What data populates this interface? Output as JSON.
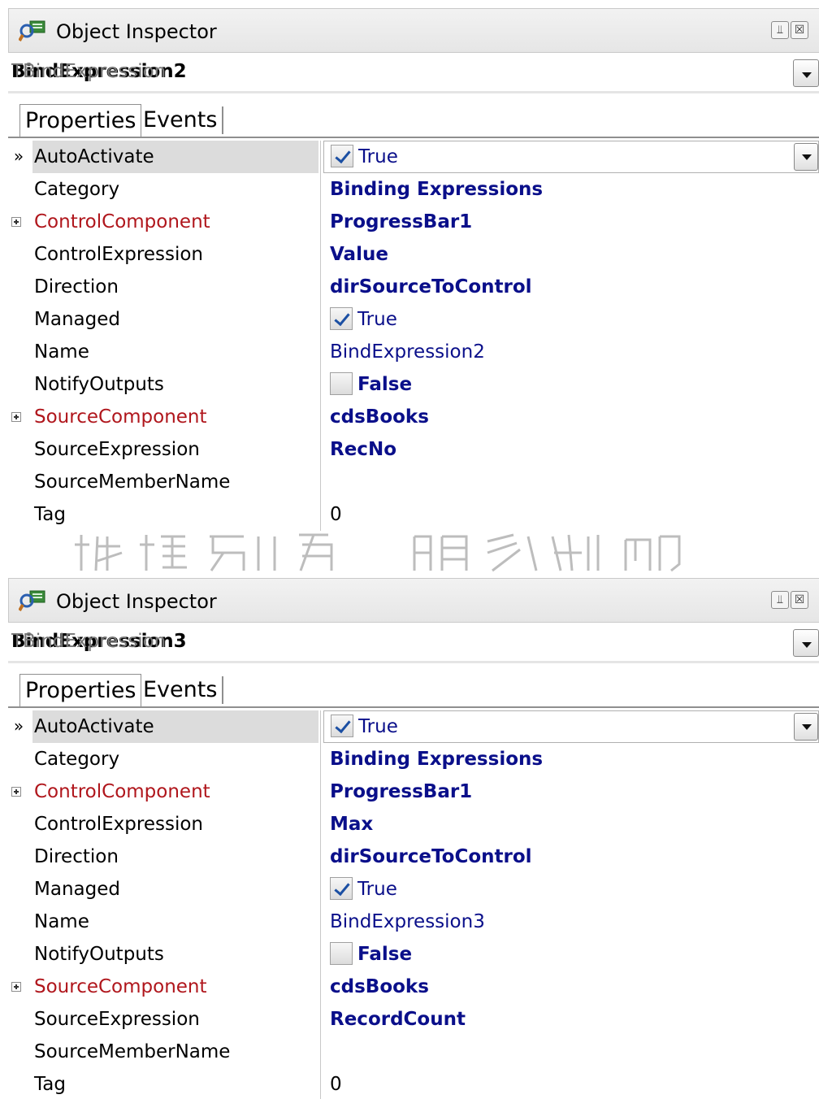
{
  "panels": [
    {
      "title": "Object Inspector",
      "object_name": "BindExpression2",
      "object_class": "TBindExpression",
      "tabs": [
        "Properties",
        "Events"
      ],
      "rows": [
        {
          "name": "AutoActivate",
          "value": "True",
          "kind": "check",
          "checked": true,
          "selected": true,
          "expandable": false,
          "red": false
        },
        {
          "name": "Category",
          "value": "Binding Expressions",
          "kind": "bold",
          "expandable": false,
          "red": false
        },
        {
          "name": "ControlComponent",
          "value": "ProgressBar1",
          "kind": "bold",
          "expandable": true,
          "red": true
        },
        {
          "name": "ControlExpression",
          "value": "Value",
          "kind": "bold",
          "expandable": false,
          "red": false
        },
        {
          "name": "Direction",
          "value": "dirSourceToControl",
          "kind": "bold",
          "expandable": false,
          "red": false
        },
        {
          "name": "Managed",
          "value": "True",
          "kind": "check",
          "checked": true,
          "expandable": false,
          "red": false
        },
        {
          "name": "Name",
          "value": "BindExpression2",
          "kind": "plain",
          "expandable": false,
          "red": false
        },
        {
          "name": "NotifyOutputs",
          "value": "False",
          "kind": "check",
          "checked": false,
          "expandable": false,
          "red": false
        },
        {
          "name": "SourceComponent",
          "value": "cdsBooks",
          "kind": "bold",
          "expandable": true,
          "red": true
        },
        {
          "name": "SourceExpression",
          "value": "RecNo",
          "kind": "bold",
          "expandable": false,
          "red": false
        },
        {
          "name": "SourceMemberName",
          "value": "",
          "kind": "plain",
          "expandable": false,
          "red": false
        },
        {
          "name": "Tag",
          "value": "0",
          "kind": "black",
          "expandable": false,
          "red": false
        }
      ]
    },
    {
      "title": "Object Inspector",
      "object_name": "BindExpression3",
      "object_class": "TBindExpression",
      "tabs": [
        "Properties",
        "Events"
      ],
      "rows": [
        {
          "name": "AutoActivate",
          "value": "True",
          "kind": "check",
          "checked": true,
          "selected": true,
          "expandable": false,
          "red": false
        },
        {
          "name": "Category",
          "value": "Binding Expressions",
          "kind": "bold",
          "expandable": false,
          "red": false
        },
        {
          "name": "ControlComponent",
          "value": "ProgressBar1",
          "kind": "bold",
          "expandable": true,
          "red": true
        },
        {
          "name": "ControlExpression",
          "value": "Max",
          "kind": "bold",
          "expandable": false,
          "red": false
        },
        {
          "name": "Direction",
          "value": "dirSourceToControl",
          "kind": "bold",
          "expandable": false,
          "red": false
        },
        {
          "name": "Managed",
          "value": "True",
          "kind": "check",
          "checked": true,
          "expandable": false,
          "red": false
        },
        {
          "name": "Name",
          "value": "BindExpression3",
          "kind": "plain",
          "expandable": false,
          "red": false
        },
        {
          "name": "NotifyOutputs",
          "value": "False",
          "kind": "check",
          "checked": false,
          "expandable": false,
          "red": false
        },
        {
          "name": "SourceComponent",
          "value": "cdsBooks",
          "kind": "bold",
          "expandable": true,
          "red": true
        },
        {
          "name": "SourceExpression",
          "value": "RecordCount",
          "kind": "bold",
          "expandable": false,
          "red": false
        },
        {
          "name": "SourceMemberName",
          "value": "",
          "kind": "plain",
          "expandable": false,
          "red": false
        },
        {
          "name": "Tag",
          "value": "0",
          "kind": "black",
          "expandable": false,
          "red": false
        }
      ]
    }
  ],
  "icons": {
    "app": "object-inspector-icon",
    "pin": "pin-icon",
    "close": "close-icon",
    "dropdown": "chevron-down-icon",
    "expand": "plus-box-icon",
    "current_row": "double-chevron-right-icon"
  },
  "watermark_text": "版權所有 萌幻翻印",
  "colors": {
    "value_text": "#0a0f8a",
    "event_prop": "#b0161c",
    "selected_row": "#dcdcdc"
  }
}
